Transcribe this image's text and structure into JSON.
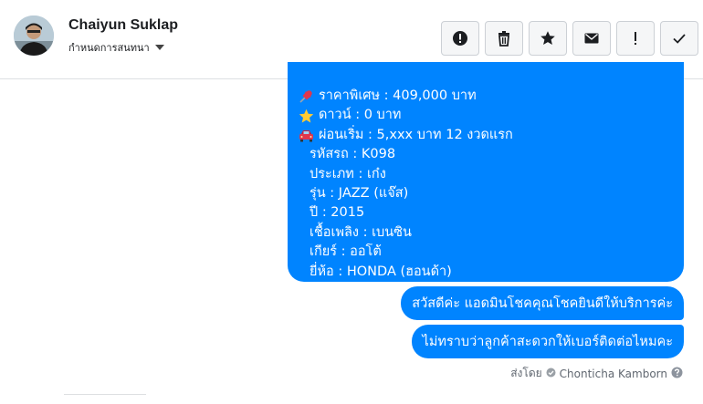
{
  "contact": {
    "name": "Chaiyun Suklap",
    "label_action": "กำหนดการสนทนา"
  },
  "actions": [
    {
      "icon": "alert-circle-icon"
    },
    {
      "icon": "trash-icon"
    },
    {
      "icon": "star-icon"
    },
    {
      "icon": "envelope-icon"
    },
    {
      "icon": "exclamation-icon"
    },
    {
      "icon": "check-icon"
    }
  ],
  "message_main": {
    "lines": [
      {
        "icon": "pushpin-icon",
        "text": "ราคาพิเศษ : 409,000 บาท"
      },
      {
        "icon": "star-emoji-icon",
        "text": "ดาวน์ : 0 บาท"
      },
      {
        "icon": "car-icon",
        "text": "ผ่อนเริ่ม : 5,xxx บาท 12 งวดแรก"
      },
      {
        "text": "รหัสรถ : K098"
      },
      {
        "text": "ประเภท : เก๋ง"
      },
      {
        "text": "รุ่น : JAZZ (แจ๊ส)"
      },
      {
        "text": "ปี : 2015"
      },
      {
        "text": "เชื้อเพลิง : เบนซิน"
      },
      {
        "text": "เกียร์ : ออโต้"
      },
      {
        "text": "ยี่ห้อ : HONDA (ฮอนด้า)"
      }
    ]
  },
  "message_2": "สวัสดีค่ะ แอดมินโชคคุณโชคยินดีให้บริการค่ะ",
  "message_3": "ไม่ทราบว่าลูกค้าสะดวกให้เบอร์ติดต่อไหมคะ",
  "sent_by": {
    "prefix": "ส่งโดย",
    "name": "Chonticha Kamborn"
  },
  "colors": {
    "bubble": "#0084ff",
    "border": "#dddfe2"
  }
}
